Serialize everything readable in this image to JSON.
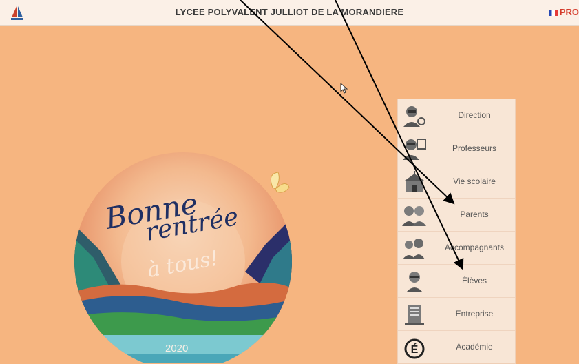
{
  "header": {
    "title": "LYCEE POLYVALENT JULLIOT DE LA MORANDIERE",
    "lang_label": "PRO",
    "logo_icon": "sailboat-logo-icon"
  },
  "menu": {
    "items": [
      {
        "label": "Direction",
        "icon": "direction-icon"
      },
      {
        "label": "Professeurs",
        "icon": "teacher-icon"
      },
      {
        "label": "Vie scolaire",
        "icon": "school-building-icon"
      },
      {
        "label": "Parents",
        "icon": "parents-icon"
      },
      {
        "label": "Accompagnants",
        "icon": "companions-icon"
      },
      {
        "label": "Élèves",
        "icon": "student-icon"
      },
      {
        "label": "Entreprise",
        "icon": "company-icon"
      },
      {
        "label": "Académie",
        "icon": "academie-icon"
      }
    ]
  },
  "banner": {
    "line1": "Bonne",
    "line2": "rentrée",
    "line3": "à tous!",
    "year": "2020"
  },
  "colors": {
    "background": "#f6b580",
    "topbar": "#fbf0e7",
    "menu": "#f8e6d6",
    "accent_red": "#d43a2a",
    "script_blue": "#1f2f63"
  }
}
